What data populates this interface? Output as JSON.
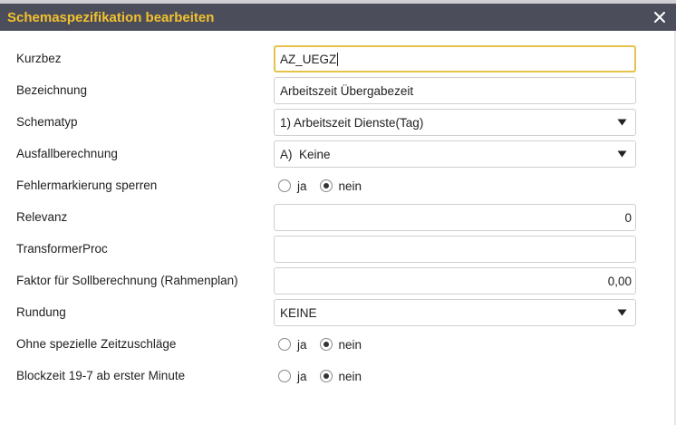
{
  "dialog": {
    "title": "Schemaspezifikation bearbeiten",
    "close_glyph": "×"
  },
  "fields": [
    {
      "label": "Kurzbez",
      "type": "text",
      "value": "AZ_UEGZ",
      "focused": true
    },
    {
      "label": "Bezeichnung",
      "type": "text",
      "value": "Arbeitszeit Übergabezeit"
    },
    {
      "label": "Schematyp",
      "type": "select",
      "value": "1) Arbeitszeit Dienste(Tag)"
    },
    {
      "label": "Ausfallberechnung",
      "type": "select",
      "value": "A)  Keine"
    },
    {
      "label": "Fehlermarkierung sperren",
      "type": "radio",
      "options": [
        "ja",
        "nein"
      ],
      "selected": "nein"
    },
    {
      "label": "Relevanz",
      "type": "number",
      "value": "0"
    },
    {
      "label": "TransformerProc",
      "type": "text",
      "value": ""
    },
    {
      "label": "Faktor für Sollberechnung (Rahmenplan)",
      "type": "number",
      "value": "0,00"
    },
    {
      "label": "Rundung",
      "type": "select",
      "value": "KEINE"
    },
    {
      "label": "Ohne spezielle Zeitzuschläge",
      "type": "radio",
      "options": [
        "ja",
        "nein"
      ],
      "selected": "nein"
    },
    {
      "label": "Blockzeit 19-7 ab erster Minute",
      "type": "radio",
      "options": [
        "ja",
        "nein"
      ],
      "selected": "nein"
    }
  ],
  "colors": {
    "title_bar": "#4c4d5a",
    "title_text": "#f2c12e",
    "focus_border": "#e6c24a"
  },
  "icons": {
    "close": "close-icon",
    "dropdown": "triangle-down-icon"
  }
}
